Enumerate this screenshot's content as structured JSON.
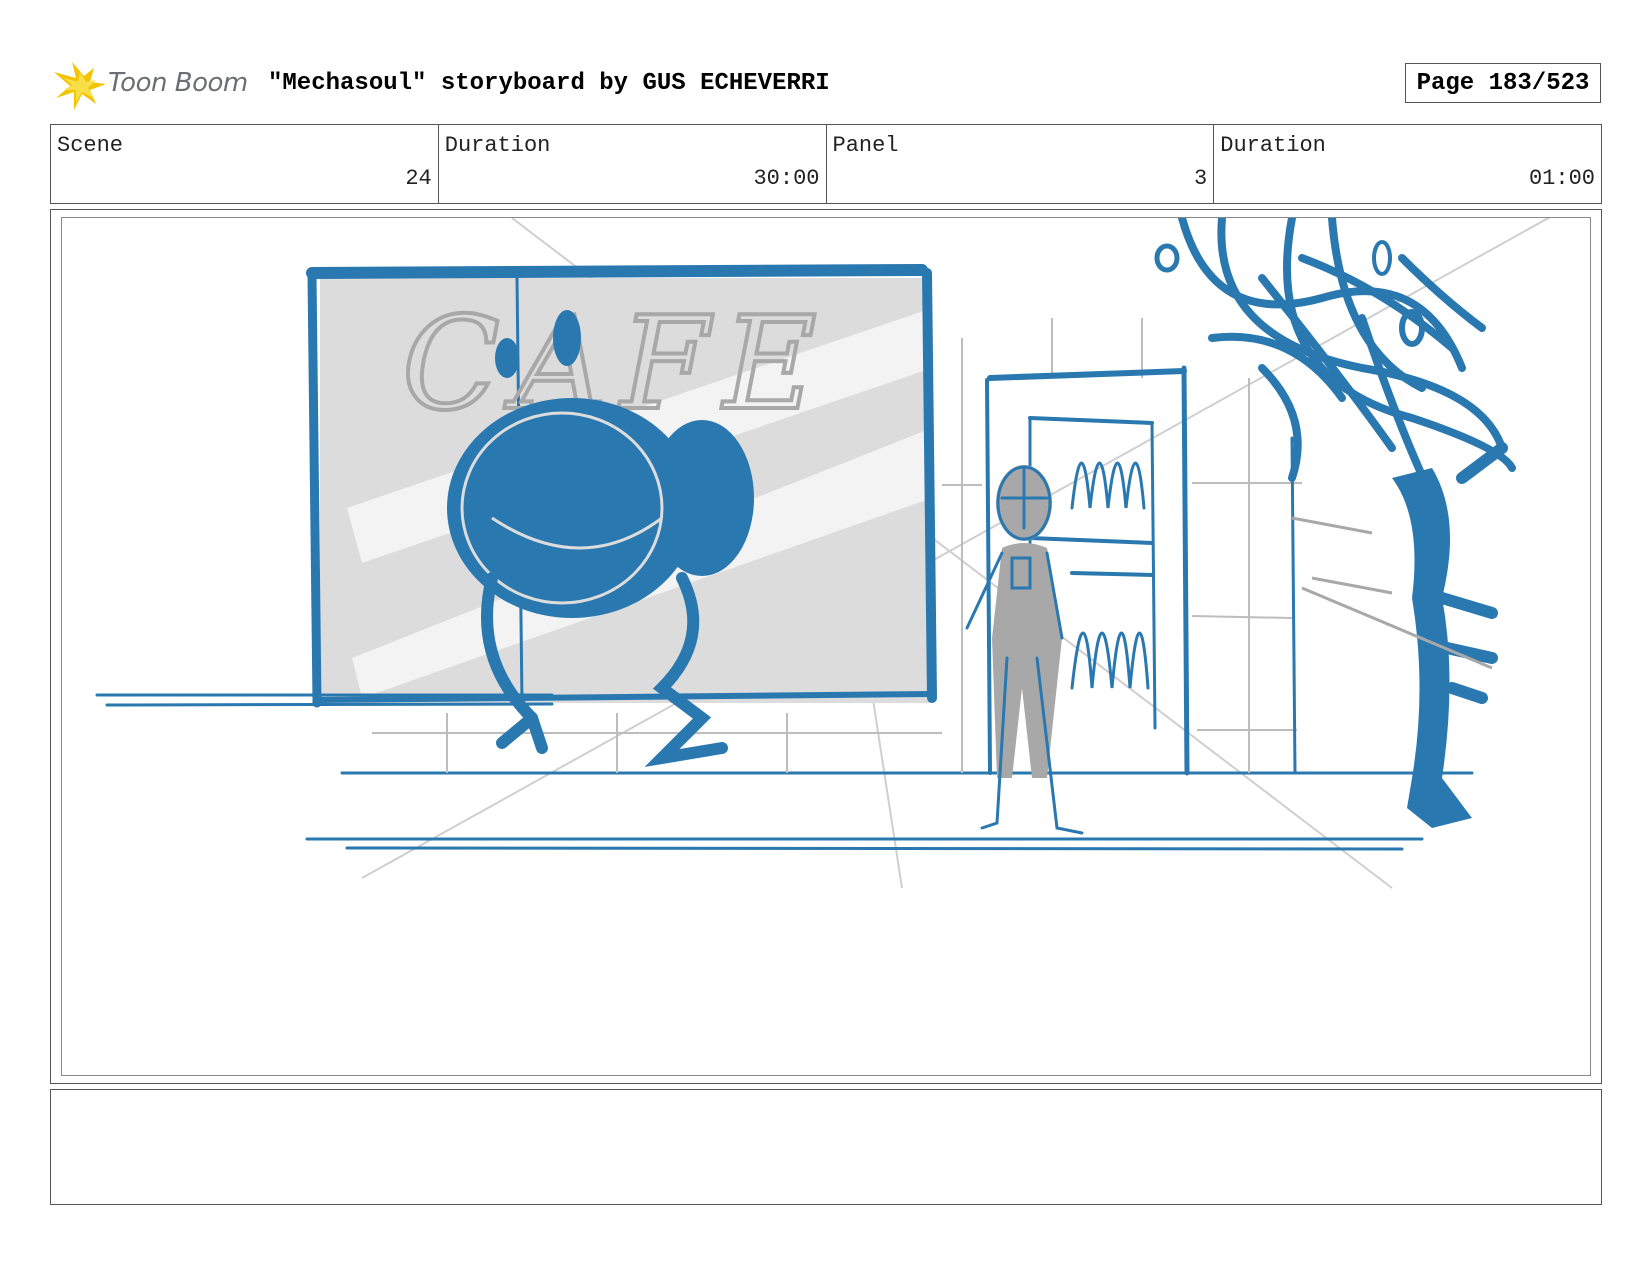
{
  "header": {
    "logo_text": "Toon Boom",
    "title": "\"Mechasoul\" storyboard by GUS ECHEVERRI",
    "page": "Page 183/523"
  },
  "info": {
    "scene_label": "Scene",
    "scene_value": "24",
    "scene_duration_label": "Duration",
    "scene_duration_value": "30:00",
    "panel_label": "Panel",
    "panel_value": "3",
    "panel_duration_label": "Duration",
    "panel_duration_value": "01:00"
  },
  "panel": {
    "sign_text": "CAFE",
    "colors": {
      "ink_blue": "#2a78b0",
      "sketch_gray": "#a8a8a8",
      "window_fill": "#dcdcdc"
    }
  },
  "notes": {
    "text": ""
  }
}
